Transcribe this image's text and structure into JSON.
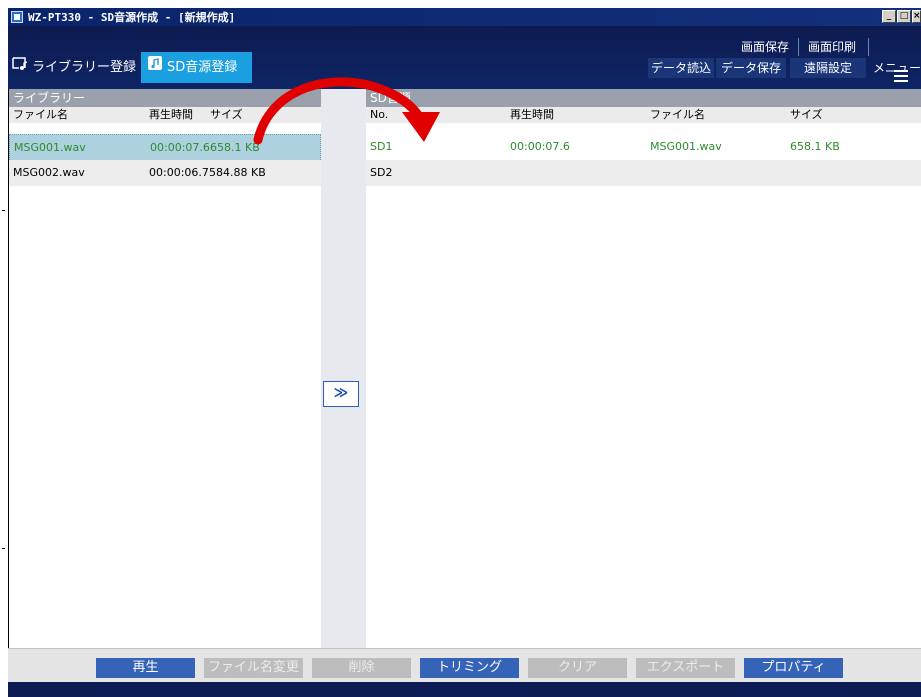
{
  "window": {
    "title": "WZ-PT330 - SD音源作成 - [新規作成]",
    "controls": {
      "minimize": "_",
      "restore": "□",
      "close": "×"
    }
  },
  "header": {
    "top_buttons": [
      "画面保存",
      "画面印刷"
    ],
    "bottom_buttons": [
      "データ読込",
      "データ保存",
      "遠隔設定"
    ],
    "menu_label": "メニュー",
    "tabs": [
      {
        "label": "ライブラリー登録",
        "icon": "library-icon",
        "active": false
      },
      {
        "label": "SD音源登録",
        "icon": "sd-music-icon",
        "active": true
      }
    ]
  },
  "library": {
    "title": "ライブラリー",
    "columns": [
      "ファイル名",
      "再生時間",
      "サイズ"
    ],
    "rows": [
      {
        "file": "MSG001.wav",
        "time": "00:00:07.6",
        "size": "658.1 KB",
        "selected": true
      },
      {
        "file": "MSG002.wav",
        "time": "00:00:06.7",
        "size": "584.88 KB",
        "selected": false
      }
    ]
  },
  "move_button": {
    "label": "≫"
  },
  "sd": {
    "title": "SD音源",
    "columns": [
      "No.",
      "再生時間",
      "ファイル名",
      "サイズ"
    ],
    "rows": [
      {
        "no": "SD1",
        "time": "00:00:07.6",
        "file": "MSG001.wav",
        "size": "658.1 KB"
      },
      {
        "no": "SD2",
        "time": "",
        "file": "",
        "size": ""
      }
    ]
  },
  "bottom_buttons": [
    {
      "label": "再生",
      "enabled": true
    },
    {
      "label": "ファイル名変更",
      "enabled": false
    },
    {
      "label": "削除",
      "enabled": false
    },
    {
      "label": "トリミング",
      "enabled": true
    },
    {
      "label": "クリア",
      "enabled": false
    },
    {
      "label": "エクスポート",
      "enabled": false
    },
    {
      "label": "プロパティ",
      "enabled": true
    }
  ],
  "colors": {
    "header_bg": "#0e2566",
    "tab_active": "#1a9fe0",
    "selected_row": "#add1df",
    "green_text": "#2e8b2e",
    "button_on": "#3463b8",
    "button_off": "#bdbdbd",
    "annotation_arrow": "#e00000"
  }
}
